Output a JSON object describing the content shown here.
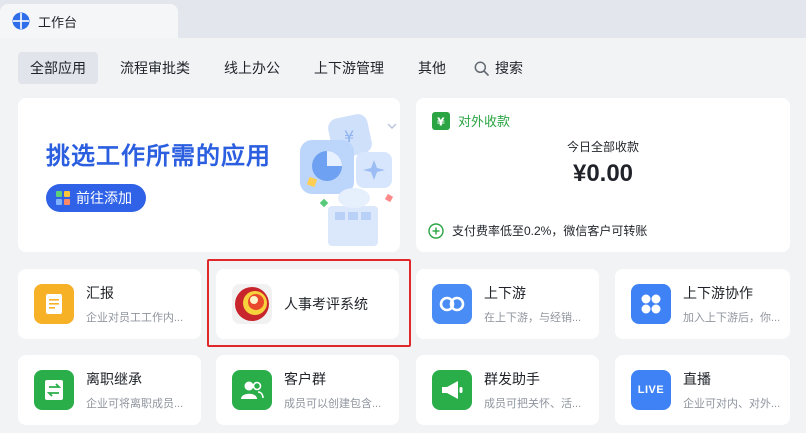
{
  "window": {
    "tab_title": "工作台"
  },
  "filters": {
    "tabs": [
      {
        "label": "全部应用"
      },
      {
        "label": "流程审批类"
      },
      {
        "label": "线上办公"
      },
      {
        "label": "上下游管理"
      },
      {
        "label": "其他"
      }
    ],
    "search_label": "搜索"
  },
  "banner": {
    "title": "挑选工作所需的应用",
    "button_label": "前往添加"
  },
  "payment": {
    "title": "对外收款",
    "today_label": "今日全部收款",
    "amount": "¥0.00",
    "note": "支付费率低至0.2%，微信客户可转账"
  },
  "apps": [
    {
      "name": "汇报",
      "desc": "企业对员工工作内...",
      "icon": "report-icon",
      "color": "#f6b126"
    },
    {
      "name": "人事考评系统",
      "desc": "",
      "icon": "hr-eval-logo-icon",
      "color": "#c8252c"
    },
    {
      "name": "上下游",
      "desc": "在上下游，与经销...",
      "icon": "link-icon",
      "color": "#4a8cf6"
    },
    {
      "name": "上下游协作",
      "desc": "加入上下游后，你...",
      "icon": "grid-icon",
      "color": "#3e82f5"
    },
    {
      "name": "离职继承",
      "desc": "企业可将离职成员...",
      "icon": "transfer-icon",
      "color": "#2aae4a"
    },
    {
      "name": "客户群",
      "desc": "成员可以创建包含...",
      "icon": "group-icon",
      "color": "#2aae4a"
    },
    {
      "name": "群发助手",
      "desc": "成员可把关怀、活...",
      "icon": "megaphone-icon",
      "color": "#2aae4a"
    },
    {
      "name": "直播",
      "desc": "企业可对内、对外...",
      "icon": "live-icon",
      "color": "#3e82f5",
      "badge": "LIVE"
    }
  ]
}
